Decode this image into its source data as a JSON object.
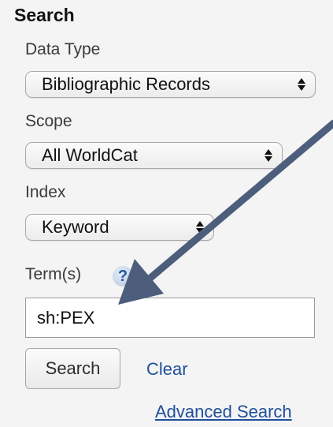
{
  "search": {
    "heading": "Search",
    "data_type": {
      "label": "Data Type",
      "selected": "Bibliographic Records"
    },
    "scope": {
      "label": "Scope",
      "selected": "All WorldCat"
    },
    "index": {
      "label": "Index",
      "selected": "Keyword"
    },
    "terms": {
      "label": "Term(s)",
      "help_symbol": "?",
      "value": "sh:PEX"
    },
    "search_button": "Search",
    "clear_link": "Clear",
    "advanced_link": "Advanced Search"
  },
  "annotation": {
    "arrow_color": "#4d5e7d"
  },
  "icons": [
    "help-icon",
    "select-arrows-icon",
    "annotation-arrow-icon"
  ]
}
